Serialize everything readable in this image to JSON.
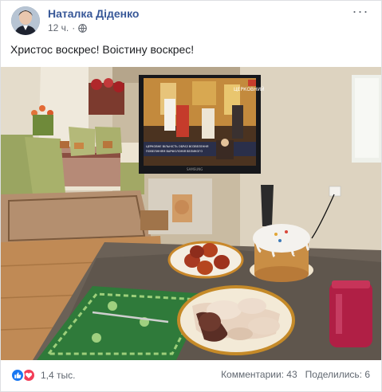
{
  "post": {
    "author": "Наталка Діденко",
    "time": "12 ч.",
    "separator": "·",
    "text": "Христос воскрес! Воістину воскрес!",
    "reactions": {
      "count": "1,4 тыс.",
      "types": [
        "like-icon",
        "love-icon"
      ]
    },
    "stats": {
      "comments": "Комментарии: 43",
      "shares": "Поделились: 6"
    },
    "tv": {
      "caption": "ЦЕРКОВНЕ ВІЛЬНІСТЬ ОБРАЗ ВОЗВЕЛЕННЯ ПОВЕЛІННЯМ ВАРФОЛОМІЯ ВЕЛИКОГО ВЕРХОВНОГО АРХІЄПИСКОПА ПОМІСНОЇ ЦЕРКВИ УКРАЇНИ",
      "channel": "ЦЕРКОВНИЙ",
      "brand": "SAMSUNG"
    },
    "colors": {
      "link": "#385898",
      "secondary": "#616770",
      "like": "#1877f2",
      "love": "#f33e58"
    }
  }
}
